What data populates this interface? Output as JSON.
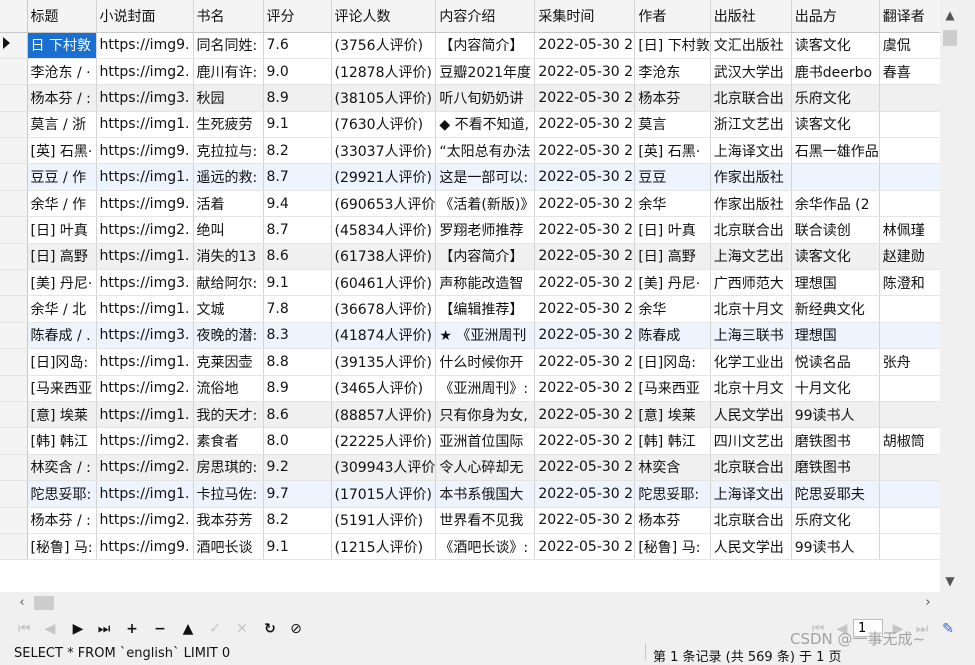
{
  "grid": {
    "columns": [
      "标题",
      "小说封面",
      "书名",
      "评分",
      "评论人数",
      "内容介绍",
      "采集时间",
      "作者",
      "出版社",
      "出品方",
      "翻译者"
    ],
    "rows": [
      [
        "日 下村敦",
        "https://img9.",
        "同名同姓:",
        "7.6",
        "(3756人评价)",
        "【内容简介】",
        "2022-05-30 2",
        "[日] 下村敦",
        "文汇出版社",
        "读客文化",
        "虞侃"
      ],
      [
        "李沧东 / ·",
        "https://img2.",
        "鹿川有许:",
        "9.0",
        "(12878人评价)",
        "豆瓣2021年度",
        "2022-05-30 2",
        "李沧东",
        "武汉大学出",
        "鹿书deerbo",
        "春喜"
      ],
      [
        "杨本芬 / :",
        "https://img3.",
        "秋园",
        "8.9",
        "(38105人评价)",
        "听八旬奶奶讲",
        "2022-05-30 2",
        "杨本芬",
        "北京联合出",
        "乐府文化",
        ""
      ],
      [
        "莫言 / 浙",
        "https://img1.",
        "生死疲劳",
        "9.1",
        "(7630人评价)",
        "◆ 不看不知道,",
        "2022-05-30 2",
        "莫言",
        "浙江文艺出",
        "读客文化",
        ""
      ],
      [
        "[英] 石黑·",
        "https://img9.",
        "克拉拉与:",
        "8.2",
        "(33037人评价)",
        "“太阳总有办法",
        "2022-05-30 2",
        "[英] 石黑·",
        "上海译文出",
        "石黑一雄作品",
        ""
      ],
      [
        "豆豆 / 作",
        "https://img1.",
        "遥远的救:",
        "8.7",
        "(29921人评价)",
        "这是一部可以:",
        "2022-05-30 2",
        "豆豆",
        "作家出版社",
        "",
        ""
      ],
      [
        "余华 / 作",
        "https://img9.",
        "活着",
        "9.4",
        "(690653人评价",
        "《活着(新版)》",
        "2022-05-30 2",
        "余华",
        "作家出版社",
        "余华作品 (2",
        ""
      ],
      [
        "[日] 叶真",
        "https://img2.",
        "绝叫",
        "8.7",
        "(45834人评价)",
        "罗翔老师推荐",
        "2022-05-30 2",
        "[日] 叶真",
        "北京联合出",
        "联合读创",
        "林佩瑾"
      ],
      [
        "[日] 高野",
        "https://img1.",
        "消失的13",
        "8.6",
        "(61738人评价)",
        "【内容简介】",
        "2022-05-30 2",
        "[日] 高野",
        "上海文艺出",
        "读客文化",
        "赵建勋"
      ],
      [
        "[美] 丹尼·",
        "https://img3.",
        "献给阿尔:",
        "9.1",
        "(60461人评价)",
        "声称能改造智",
        "2022-05-30 2",
        "[美] 丹尼·",
        "广西师范大",
        "理想国",
        "陈澄和"
      ],
      [
        "余华 / 北",
        "https://img1.",
        "文城",
        "7.8",
        "(36678人评价)",
        "【编辑推荐】",
        "2022-05-30 2",
        "余华",
        "北京十月文",
        "新经典文化",
        ""
      ],
      [
        "陈春成 / .",
        "https://img3.",
        "夜晚的潜:",
        "8.3",
        "(41874人评价)",
        "★ 《亚洲周刊",
        "2022-05-30 2",
        "陈春成",
        "上海三联书",
        "理想国",
        ""
      ],
      [
        "[日]冈岛:",
        "https://img1.",
        "克莱因壶",
        "8.8",
        "(39135人评价)",
        "什么时候你开",
        "2022-05-30 2",
        "[日]冈岛:",
        "化学工业出",
        "悦读名品",
        "张舟"
      ],
      [
        "[马来西亚",
        "https://img2.",
        "流俗地",
        "8.9",
        "(3465人评价)",
        "《亚洲周刊》:",
        "2022-05-30 2",
        "[马来西亚",
        "北京十月文",
        "十月文化",
        ""
      ],
      [
        "[意] 埃莱",
        "https://img1.",
        "我的天才:",
        "8.6",
        "(88857人评价)",
        "只有你身为女,",
        "2022-05-30 2",
        "[意] 埃莱",
        "人民文学出",
        "99读书人",
        ""
      ],
      [
        "[韩] 韩江",
        "https://img2.",
        "素食者",
        "8.0",
        "(22225人评价)",
        "亚洲首位国际",
        "2022-05-30 2",
        "[韩] 韩江",
        "四川文艺出",
        "磨铁图书",
        "胡椒筒"
      ],
      [
        "林奕含 / :",
        "https://img2.",
        "房思琪的:",
        "9.2",
        "(309943人评价",
        "令人心碎却无",
        "2022-05-30 2",
        "林奕含",
        "北京联合出",
        "磨铁图书",
        ""
      ],
      [
        "陀思妥耶:",
        "https://img1.",
        "卡拉马佐:",
        "9.7",
        "(17015人评价)",
        "本书系俄国大",
        "2022-05-30 2",
        "陀思妥耶:",
        "上海译文出",
        "陀思妥耶夫",
        ""
      ],
      [
        "杨本芬 / :",
        "https://img2.",
        "我本芬芳",
        "8.2",
        "(5191人评价)",
        "世界看不见我",
        "2022-05-30 2",
        "杨本芬",
        "北京联合出",
        "乐府文化",
        ""
      ],
      [
        "[秘鲁] 马:",
        "https://img9.",
        "酒吧长谈",
        "9.1",
        "(1215人评价)",
        "《酒吧长谈》:",
        "2022-05-30 2",
        "[秘鲁] 马:",
        "人民文学出",
        "99读书人",
        ""
      ]
    ]
  },
  "page": {
    "current": "1"
  },
  "status": {
    "sql": "SELECT * FROM `english` LIMIT 0",
    "records": "第 1 条记录 (共 569 条) 于 1 页"
  },
  "watermark": "CSDN @一事无成~",
  "icons": {
    "first": "first-record-icon",
    "prev": "prev-record-icon",
    "next": "next-record-icon",
    "last": "last-record-icon",
    "add": "add-record-icon",
    "delete": "delete-record-icon",
    "up": "move-up-icon",
    "apply": "apply-icon",
    "discard": "discard-icon",
    "refresh": "refresh-icon",
    "stop": "stop-icon"
  },
  "colors": {
    "selection": "#1a6fd1",
    "zebra": "#f0f0f0",
    "highlight": "#edf4fd"
  }
}
